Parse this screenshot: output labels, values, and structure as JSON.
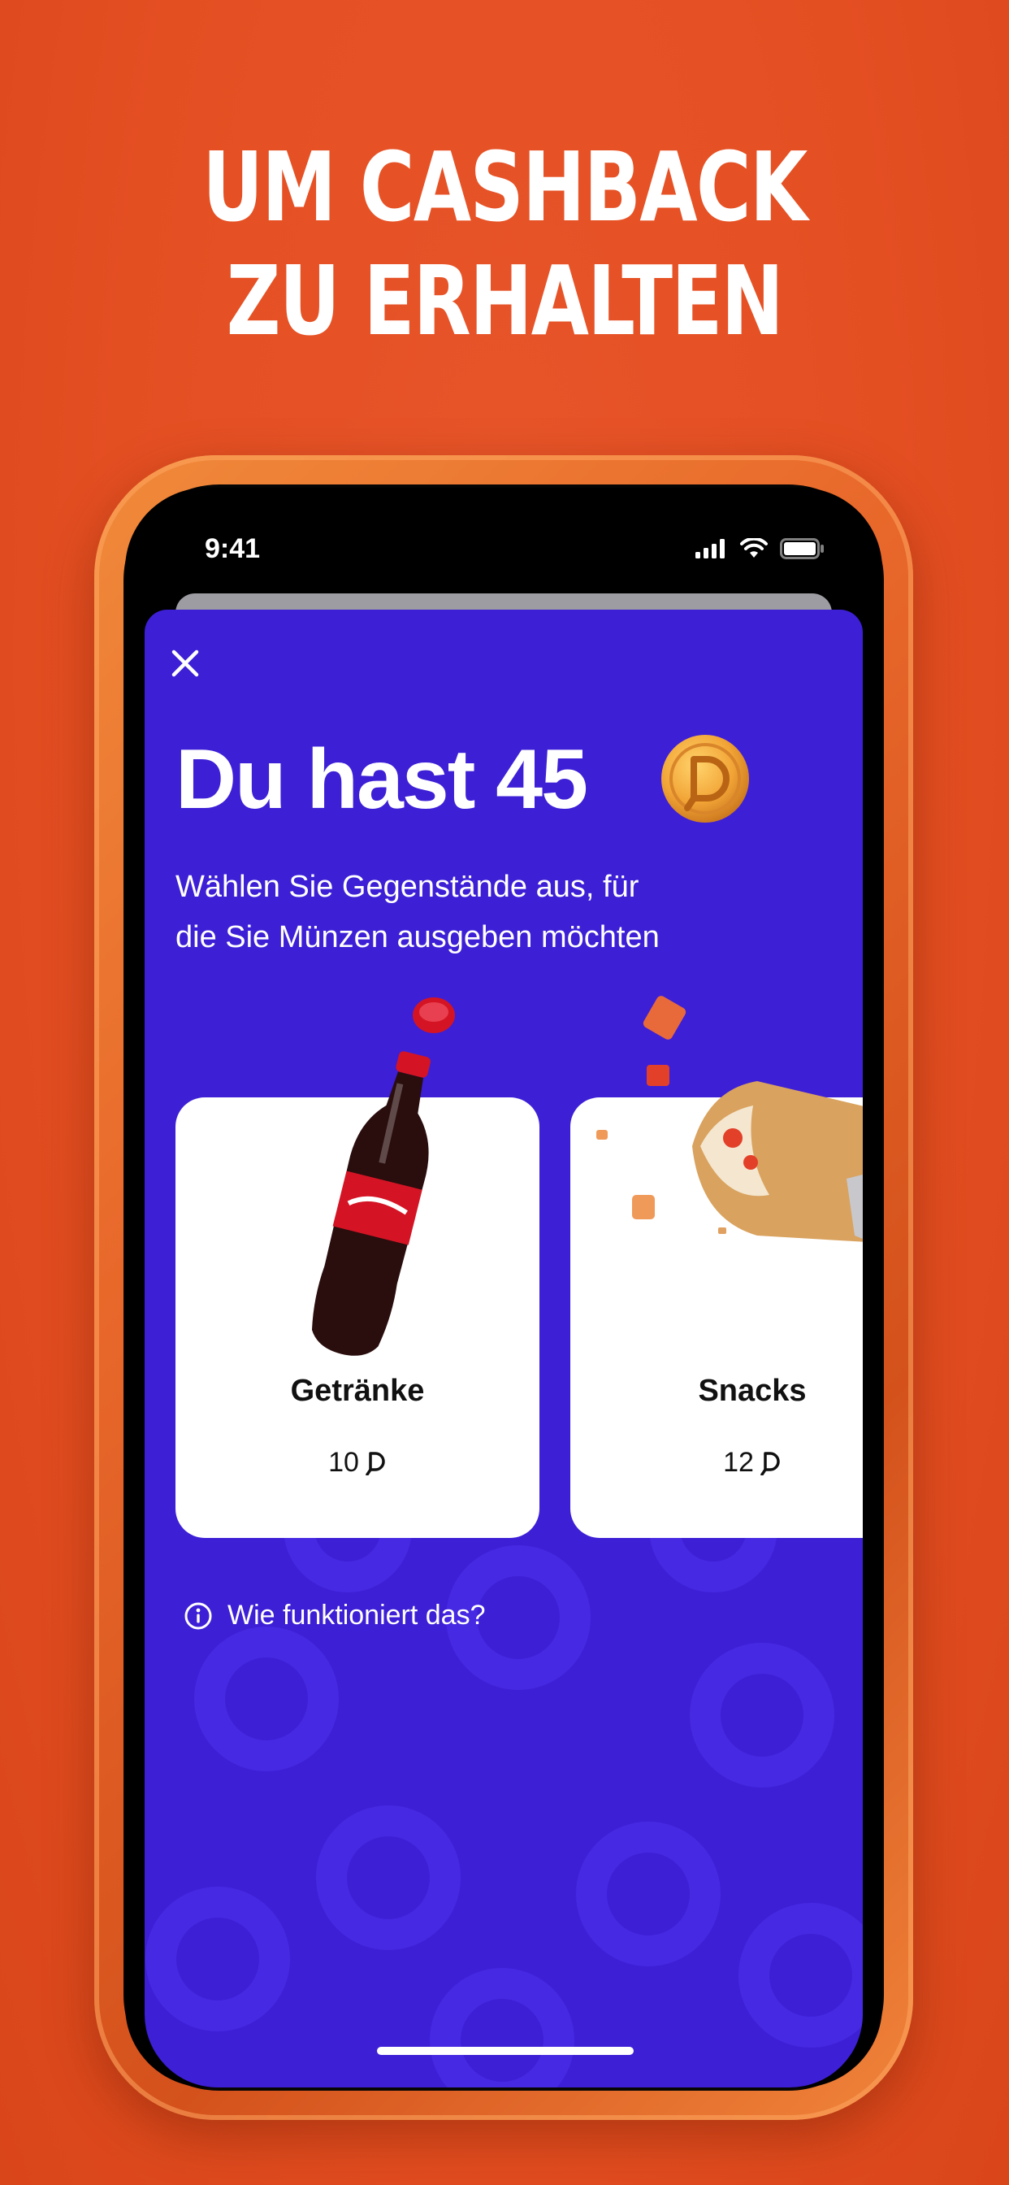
{
  "headline": {
    "line1": "UM CASHBACK",
    "line2": "ZU ERHALTEN"
  },
  "status_bar": {
    "time": "9:41",
    "icons": [
      "signal-icon",
      "wifi-icon",
      "battery-icon"
    ]
  },
  "sheet": {
    "title": "Du hast 45",
    "coin_icon": "coin-icon",
    "subtitle": "Wählen Sie Gegenstände aus, für die Sie Münzen ausgeben möchten",
    "cards": [
      {
        "name": "Getränke",
        "price": "10",
        "image": "cola-bottle-image"
      },
      {
        "name": "Snacks",
        "price": "12",
        "image": "wrap-snack-image"
      }
    ],
    "info_link": "Wie funktioniert das?"
  },
  "colors": {
    "background": "#e44f22",
    "sheet": "#3d1fd6",
    "card": "#ffffff",
    "coin": "#f0a534"
  }
}
